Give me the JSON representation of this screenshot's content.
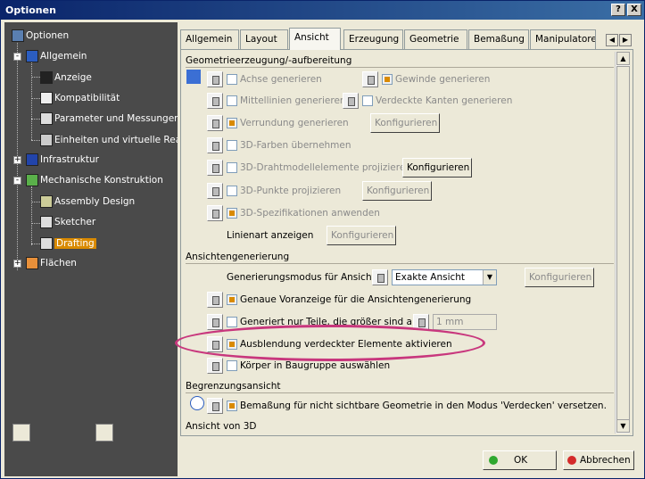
{
  "window": {
    "title": "Optionen",
    "help_label": "?",
    "close_label": "X"
  },
  "tree": {
    "items": [
      {
        "label": "Optionen",
        "icon": "options-icon"
      },
      {
        "label": "Allgemein",
        "icon": "general-icon"
      },
      {
        "label": "Anzeige",
        "icon": "display-icon"
      },
      {
        "label": "Kompatibilität",
        "icon": "compatibility-icon"
      },
      {
        "label": "Parameter und Messungen",
        "icon": "parameters-icon"
      },
      {
        "label": "Einheiten und virtuelle Realit",
        "icon": "units-icon"
      },
      {
        "label": "Infrastruktur",
        "icon": "infrastructure-icon"
      },
      {
        "label": "Mechanische Konstruktion",
        "icon": "mechanical-design-icon"
      },
      {
        "label": "Assembly Design",
        "icon": "assembly-design-icon"
      },
      {
        "label": "Sketcher",
        "icon": "sketcher-icon"
      },
      {
        "label": "Drafting",
        "icon": "drafting-icon"
      },
      {
        "label": "Flächen",
        "icon": "surfaces-icon"
      }
    ],
    "expander_minus": "-",
    "expander_plus": "+"
  },
  "tabs": [
    "Allgemein",
    "Layout",
    "Ansicht",
    "Erzeugung",
    "Geometrie",
    "Bemaßung",
    "Manipulatoren"
  ],
  "active_tab": "Ansicht",
  "sections": {
    "geometry": {
      "title": "Geometrieerzeugung/-aufbereitung",
      "axis": "Achse generieren",
      "thread": "Gewinde generieren",
      "centerlines": "Mittellinien generieren",
      "hidden_edges": "Verdeckte Kanten generieren",
      "fillet": "Verrundung generieren",
      "colors3d": "3D-Farben übernehmen",
      "wireframe": "3D-Drahtmodellelemente projizieren",
      "points3d": "3D-Punkte projizieren",
      "spec3d": "3D-Spezifikationen anwenden",
      "linetype": "Linienart anzeigen"
    },
    "view_generation": {
      "title": "Ansichtengenerierung",
      "mode_label": "Generierungsmodus für Ansichten",
      "mode_value": "Exakte Ansicht",
      "exact_preview": "Genaue Voranzeige für die Ansichtengenerierung",
      "only_parts": "Generiert nur Teile, die größer sind als",
      "size_value": "1 mm",
      "hide_hidden": "Ausblendung verdeckter Elemente aktivieren",
      "bodies": "Körper in Baugruppe auswählen"
    },
    "boundary": {
      "title": "Begrenzungsansicht",
      "dimension": "Bemaßung für nicht sichtbare Geometrie in den Modus 'Verdecken' versetzen."
    },
    "view3d": {
      "title": "Ansicht von 3D"
    }
  },
  "buttons": {
    "configure": "Konfigurieren",
    "ok": "OK",
    "cancel": "Abbrechen"
  },
  "colors": {
    "highlight": "#c8377d",
    "selection": "#d98a00",
    "ok_dot": "#2fa82f",
    "cancel_dot": "#d42a2a"
  }
}
